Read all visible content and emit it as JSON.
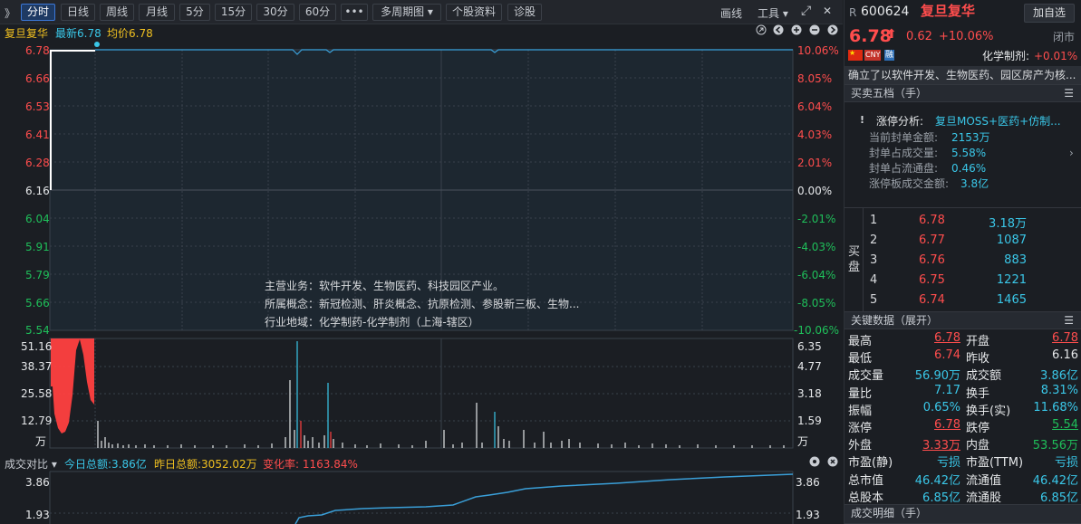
{
  "toolbar": {
    "collapse": "》",
    "tabs": [
      "分时",
      "日线",
      "周线",
      "月线",
      "5分",
      "15分",
      "30分",
      "60分",
      "•••",
      "多周期图 ▾",
      "个股资料",
      "诊股"
    ],
    "draw": "画线",
    "tools": "工具 ▾",
    "expand": "⤢",
    "close": "✕"
  },
  "info": {
    "name": "复旦复华",
    "latest": "最新6.78",
    "avg": "均价6.78"
  },
  "price_axis": {
    "left": [
      "6.78",
      "6.66",
      "6.53",
      "6.41",
      "6.28",
      "6.16",
      "6.04",
      "5.91",
      "5.79",
      "5.66",
      "5.54"
    ],
    "right": [
      "10.06%",
      "8.05%",
      "6.04%",
      "4.03%",
      "2.01%",
      "0.00%",
      "-2.01%",
      "-4.03%",
      "-6.04%",
      "-8.05%",
      "-10.06%"
    ]
  },
  "overlay": {
    "business": "主营业务：软件开发、生物医药、科技园区产业。",
    "concept": "所属概念：新冠检测、肝炎概念、抗原检测、参股新三板、生物...",
    "industry": "行业地域：化学制药-化学制剂（上海-辖区）"
  },
  "volume_axis": {
    "left": [
      "51.16",
      "38.37",
      "25.58",
      "12.79",
      "万"
    ],
    "right": [
      "6.35",
      "4.77",
      "3.18",
      "1.59",
      "万"
    ]
  },
  "compare": {
    "label": "成交对比 ▾",
    "today": "今日总额:3.86亿",
    "yesterday": "昨日总额:3052.02万",
    "rate": "变化率: 1163.84%",
    "left": [
      "3.86",
      "1.93"
    ],
    "right": [
      "3.86",
      "1.93"
    ]
  },
  "stock": {
    "r": "R",
    "code": "600624",
    "name": "复旦复华",
    "add": "加自选",
    "price": "6.78",
    "arrow": "⬆",
    "chg": "0.62",
    "pct": "+10.06%",
    "status": "闭市",
    "sector": "化学制剂:",
    "sector_pct": "+0.01%",
    "cny": "CNY",
    "rong": "融",
    "desc": "确立了以软件开发、生物医药、园区房产为核..."
  },
  "orderbook": {
    "title": "买卖五档（手）",
    "limit_label": "涨停分析:",
    "limit_topic": "复旦MOSS+医药+仿制...",
    "rows": [
      {
        "k": "当前封单金额:",
        "v": "2153万"
      },
      {
        "k": "封单占成交量:",
        "v": "5.58%"
      },
      {
        "k": "封单占流通盘:",
        "v": "0.46%"
      },
      {
        "k": "涨停板成交金额:",
        "v": "3.8亿"
      }
    ],
    "buy_label": "买盘",
    "buys": [
      {
        "n": "1",
        "p": "6.78",
        "v": "3.18万"
      },
      {
        "n": "2",
        "p": "6.77",
        "v": "1087"
      },
      {
        "n": "3",
        "p": "6.76",
        "v": "883"
      },
      {
        "n": "4",
        "p": "6.75",
        "v": "1221"
      },
      {
        "n": "5",
        "p": "6.74",
        "v": "1465"
      }
    ]
  },
  "keydata": {
    "title": "关键数据（展开）",
    "rows": [
      [
        "最高",
        "6.78",
        "开盘",
        "6.78"
      ],
      [
        "最低",
        "6.74",
        "昨收",
        "6.16"
      ],
      [
        "成交量",
        "56.90万",
        "成交额",
        "3.86亿"
      ],
      [
        "量比",
        "7.17",
        "换手",
        "8.31%"
      ],
      [
        "振幅",
        "0.65%",
        "换手(实)",
        "11.68%"
      ],
      [
        "涨停",
        "6.78",
        "跌停",
        "5.54"
      ],
      [
        "外盘",
        "3.33万",
        "内盘",
        "53.56万"
      ],
      [
        "市盈(静)",
        "亏损",
        "市盈(TTM)",
        "亏损"
      ],
      [
        "总市值",
        "46.42亿",
        "流通值",
        "46.42亿"
      ],
      [
        "总股本",
        "6.85亿",
        "流通股",
        "6.85亿"
      ]
    ]
  },
  "detail": {
    "title": "成交明细（手）"
  }
}
